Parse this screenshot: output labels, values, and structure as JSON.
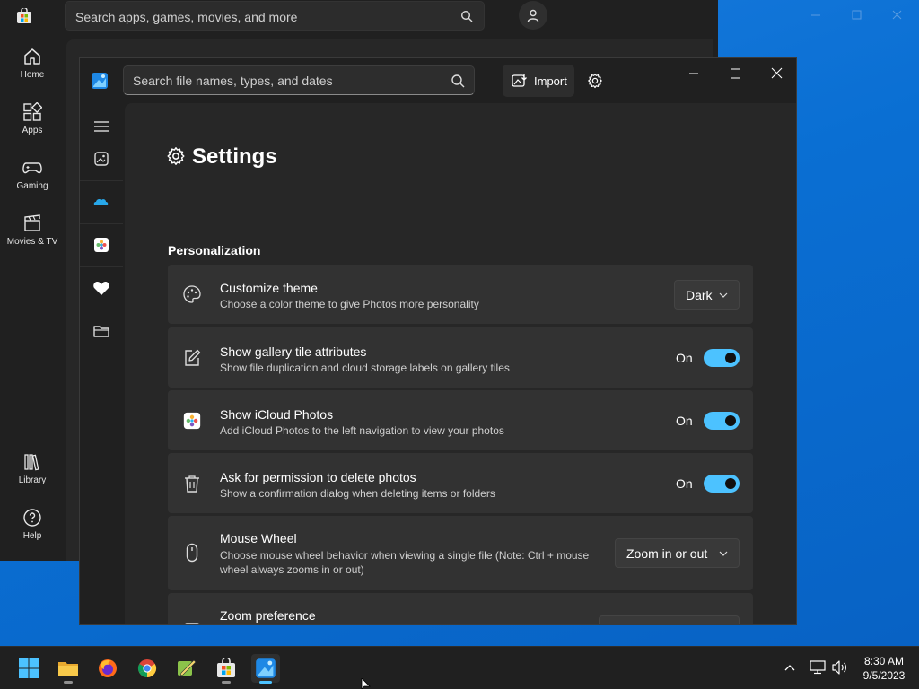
{
  "store": {
    "search_placeholder": "Search apps, games, movies, and more",
    "nav": [
      {
        "label": "Home",
        "icon": "home-icon"
      },
      {
        "label": "Apps",
        "icon": "apps-icon"
      },
      {
        "label": "Gaming",
        "icon": "gamepad-icon"
      },
      {
        "label": "Movies & TV",
        "icon": "clapperboard-icon"
      },
      {
        "label": "Library",
        "icon": "library-icon"
      },
      {
        "label": "Help",
        "icon": "help-icon"
      }
    ]
  },
  "photos": {
    "search_placeholder": "Search file names, types, and dates",
    "import_label": "Import",
    "settings_title": "Settings",
    "section_title": "Personalization",
    "settings": [
      {
        "title": "Customize theme",
        "desc": "Choose a color theme to give Photos more personality",
        "control": "dropdown",
        "value": "Dark",
        "icon": "palette-icon"
      },
      {
        "title": "Show gallery tile attributes",
        "desc": "Show file duplication and cloud storage labels on gallery tiles",
        "control": "toggle",
        "value": "On",
        "icon": "edit-icon"
      },
      {
        "title": "Show iCloud Photos",
        "desc": "Add iCloud Photos to the left navigation to view your photos",
        "control": "toggle",
        "value": "On",
        "icon": "icloud-photos-icon"
      },
      {
        "title": "Ask for permission to delete photos",
        "desc": "Show a confirmation dialog when deleting items or folders",
        "control": "toggle",
        "value": "On",
        "icon": "trash-icon"
      },
      {
        "title": "Mouse Wheel",
        "desc": "Choose mouse wheel behavior when viewing a single file (Note: Ctrl + mouse wheel always zooms in or out)",
        "control": "dropdown",
        "value": "Zoom in or out",
        "icon": "mouse-icon"
      },
      {
        "title": "Zoom preference",
        "desc": "",
        "control": "dropdown",
        "value": "",
        "icon": "zoom-icon"
      }
    ]
  },
  "taskbar": {
    "apps": [
      "start-icon",
      "file-explorer-icon",
      "firefox-icon",
      "chrome-icon",
      "pen-app-icon",
      "store-icon",
      "photos-icon"
    ],
    "time": "8:30 AM",
    "date": "9/5/2023"
  },
  "colors": {
    "accent": "#4cc2ff",
    "window_bg": "#202020",
    "card_bg": "#323232",
    "desktop": "#0b73d6"
  }
}
